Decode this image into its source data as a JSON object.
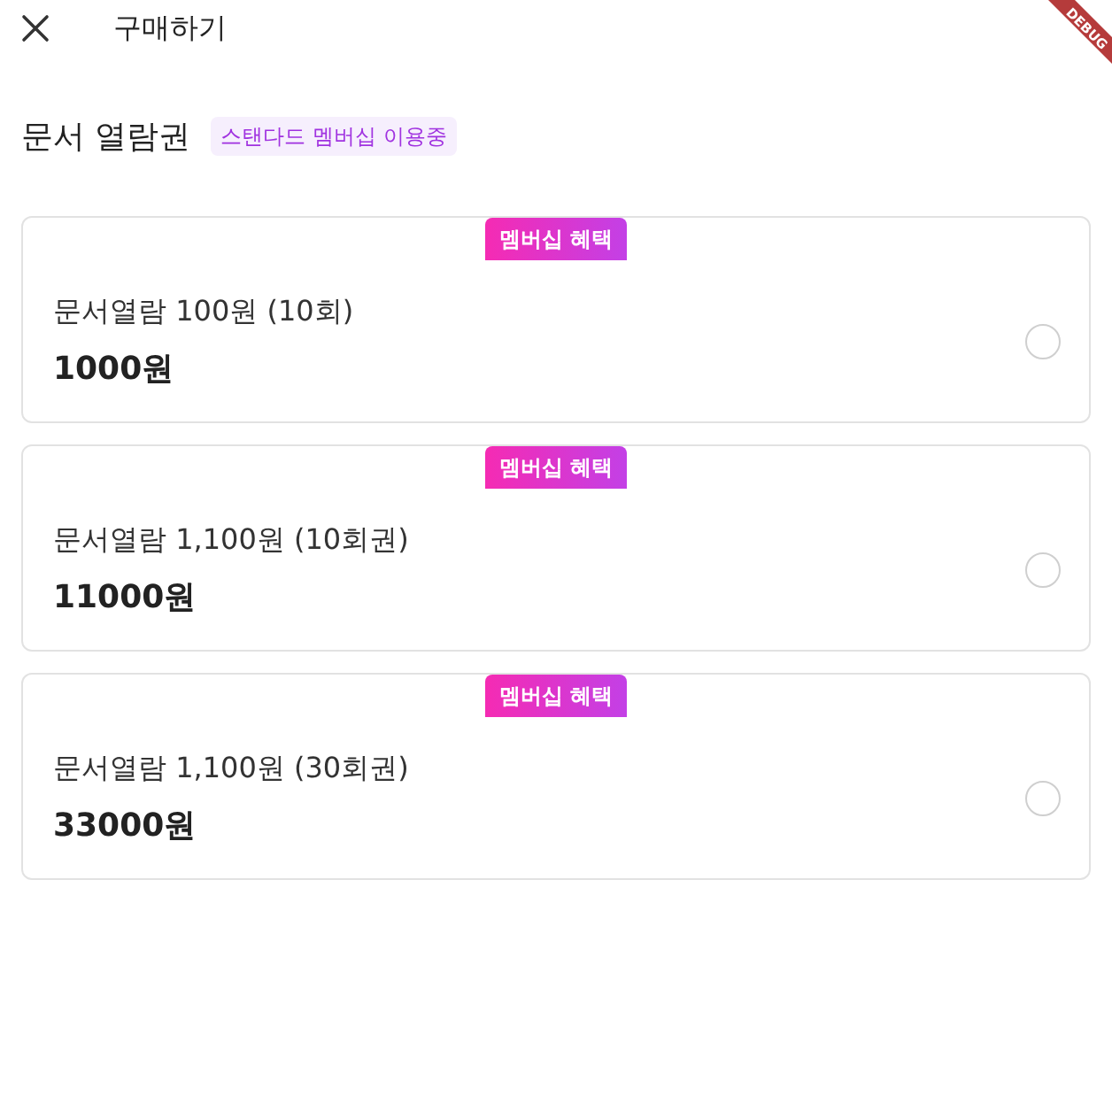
{
  "header": {
    "title": "구매하기"
  },
  "debug_banner": "DEBUG",
  "section": {
    "title": "문서 열람권",
    "membership_badge": "스탠다드 멤버십 이용중"
  },
  "options": [
    {
      "badge": "멤버십 혜택",
      "name": "문서열람 100원 (10회)",
      "price": "1000원",
      "selected": false
    },
    {
      "badge": "멤버십 혜택",
      "name": "문서열람 1,100원 (10회권)",
      "price": "11000원",
      "selected": false
    },
    {
      "badge": "멤버십 혜택",
      "name": "문서열람 1,100원 (30회권)",
      "price": "33000원",
      "selected": false
    }
  ]
}
